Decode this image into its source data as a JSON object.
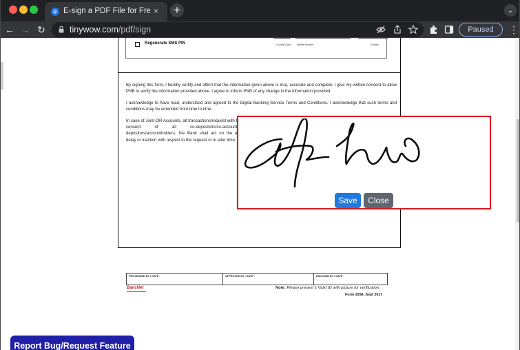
{
  "browser": {
    "tab_title": "E-sign a PDF File for Free (no sign-up)",
    "tab_close": "×",
    "new_tab": "+",
    "tab_menu": "⌄",
    "url_host": "tinywow.com",
    "url_path": "/pdf/sign",
    "profile_label": "Paused",
    "accent": "#8ab4f8",
    "traffic_lights": [
      "#ff5f57",
      "#febc2e",
      "#28c840"
    ]
  },
  "toolbar_icons": {
    "back": "←",
    "forward": "→",
    "reload": "↻",
    "kebab": "⋮"
  },
  "document": {
    "regenerate_label": "Regenerate SMS PIN",
    "country_code_label": "Country Code",
    "mobile_number_label": "Mobile Number",
    "country_label": "Country",
    "paragraphs": [
      "By signing this form, I hereby certify and affirm that the information given above is true, accurate and complete. I give my written consent to allow PNB to verify the information provided above. I agree to inform PNB of any change in the information provided.",
      "I acknowledge to have read, understood and agreed to the Digital Banking Service Terms and Conditions. I acknowledge that such terms and conditions may be amended from time to time.",
      "In case of Joint-OR Accounts, all transactions/request with the consent of all co-depositors/co-accountho depositors/accountholders, the Bank shall act on the any delay or inaction with respect to the request or in later time."
    ]
  },
  "signature_dialog": {
    "save_label": "Save",
    "close_label": "Close",
    "border_color": "#d21f24"
  },
  "footer": {
    "processed_label": "PROCESSED BY / DATE :",
    "approved_label": "APPROVED BY / DATE :",
    "encoded_label": "ENCODED BY / DATE :",
    "bancnet_logo": "BancNet",
    "note_label": "Note:",
    "note_text": "Please present 1 Valid ID with picture for verification.",
    "form_code": "Form 2058, Sept 2017"
  },
  "report_button_label": "Report Bug/Request Feature"
}
